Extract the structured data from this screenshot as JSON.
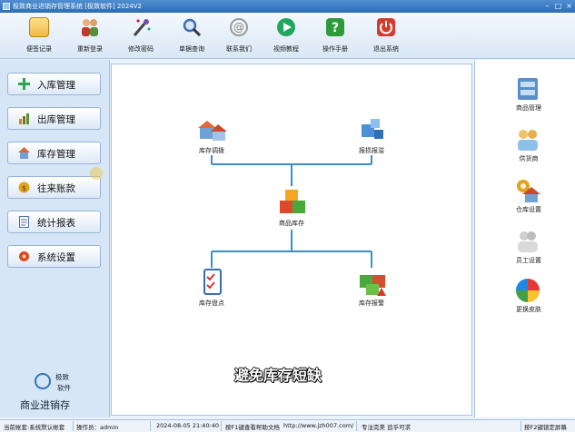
{
  "window": {
    "title": "极致商业进销存管理系统 [极致软件] 2024V2"
  },
  "toolbar": [
    {
      "label": "便签记录",
      "icon": "notepad-icon",
      "color": "#f1b94a"
    },
    {
      "label": "重新登录",
      "icon": "users-icon",
      "color": "#5a8f3a"
    },
    {
      "label": "修改密码",
      "icon": "magic-wand-icon",
      "color": "#7a4ab8"
    },
    {
      "label": "单据查询",
      "icon": "magnifier-icon",
      "color": "#3f6db3"
    },
    {
      "label": "联系我们",
      "icon": "at-sign-icon",
      "color": "#9a9a9a"
    },
    {
      "label": "视频教程",
      "icon": "play-icon",
      "color": "#1fa85c"
    },
    {
      "label": "操作手册",
      "icon": "help-icon",
      "color": "#2e9b3b"
    },
    {
      "label": "退出系统",
      "icon": "power-icon",
      "color": "#d33a2c"
    }
  ],
  "sidebar": [
    {
      "label": "入库管理",
      "icon": "plus-icon",
      "color": "#2ea44f"
    },
    {
      "label": "出库管理",
      "icon": "chart-icon",
      "color": "#c98a1a"
    },
    {
      "label": "库存管理",
      "icon": "house-icon",
      "color": "#d46a3a"
    },
    {
      "label": "往来账款",
      "icon": "coins-icon",
      "color": "#e0a321"
    },
    {
      "label": "统计报表",
      "icon": "document-icon",
      "color": "#4b6fa8"
    },
    {
      "label": "系统设置",
      "icon": "gear-icon",
      "color": "#d8491f"
    }
  ],
  "logo": {
    "line1": "极致",
    "line2": "软件",
    "line3": "商业进销存"
  },
  "flow": {
    "nodes": [
      {
        "label": "库存调拨",
        "icon": "houses-icon"
      },
      {
        "label": "报损报溢",
        "icon": "cubes-blue-icon"
      },
      {
        "label": "商品库存",
        "icon": "boxes-icon"
      },
      {
        "label": "库存盘点",
        "icon": "checklist-icon"
      },
      {
        "label": "库存报警",
        "icon": "alarm-boxes-icon"
      }
    ],
    "line_color": "#3a8ec9"
  },
  "right_panel": [
    {
      "label": "商品管理",
      "icon": "cabinet-icon"
    },
    {
      "label": "供货商",
      "icon": "suppliers-icon"
    },
    {
      "label": "仓库设置",
      "icon": "warehouse-icon"
    },
    {
      "label": "员工设置",
      "icon": "employees-icon"
    },
    {
      "label": "更换皮肤",
      "icon": "color-wheel-icon"
    }
  ],
  "caption": "避免库存短缺",
  "statusbar": {
    "account": "当前帐套:系统默认帐套",
    "operator": "操作员：admin",
    "datetime": "2024-08-05 21:40:40",
    "help": "按F1键查看帮助文档",
    "url": "http://www.jzh007.com/",
    "slogan": "专注完美 追乎可求",
    "lock": "按F2键锁定屏幕"
  }
}
